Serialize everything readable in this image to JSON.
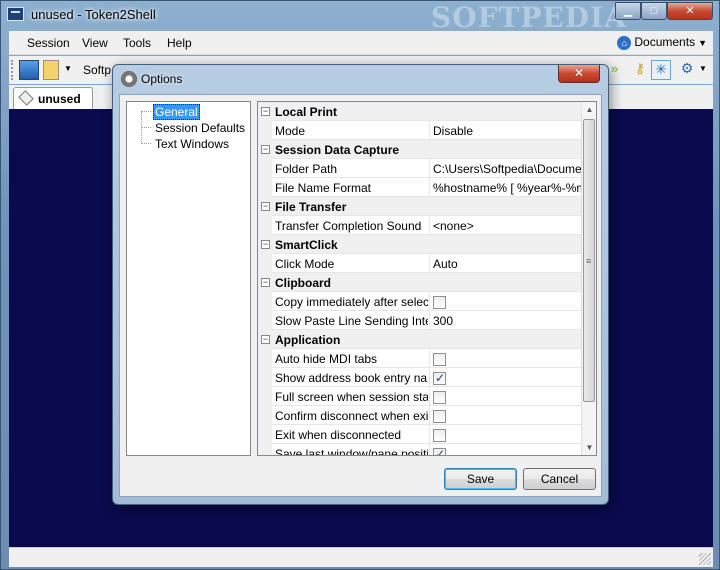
{
  "window": {
    "title": "unused - Token2Shell",
    "watermark": "SOFTPEDIA"
  },
  "menubar": {
    "items": [
      "Session",
      "View",
      "Tools",
      "Help"
    ],
    "documents_label": "Documents"
  },
  "toolbar": {
    "address_text": "Softp"
  },
  "tabs": [
    {
      "label": "unused"
    }
  ],
  "dialog": {
    "title": "Options",
    "tree": [
      "General",
      "Session Defaults",
      "Text Windows"
    ],
    "selected_tree_item": "General",
    "categories": [
      {
        "name": "Local Print",
        "rows": [
          {
            "name": "Mode",
            "value": "Disable"
          }
        ]
      },
      {
        "name": "Session Data Capture",
        "rows": [
          {
            "name": "Folder Path",
            "value": "C:\\Users\\Softpedia\\Docume"
          },
          {
            "name": "File Name Format",
            "value": "%hostname% [ %year%-%m"
          }
        ]
      },
      {
        "name": "File Transfer",
        "rows": [
          {
            "name": "Transfer Completion Sound",
            "value": "<none>"
          }
        ]
      },
      {
        "name": "SmartClick",
        "rows": [
          {
            "name": "Click Mode",
            "value": "Auto"
          }
        ]
      },
      {
        "name": "Clipboard",
        "rows": [
          {
            "name": "Copy immediately after selec",
            "checkbox": false
          },
          {
            "name": "Slow Paste Line Sending Inter",
            "value": "300"
          }
        ]
      },
      {
        "name": "Application",
        "rows": [
          {
            "name": "Auto hide MDI tabs",
            "checkbox": false
          },
          {
            "name": "Show address book entry nar",
            "checkbox": true
          },
          {
            "name": "Full screen when session start",
            "checkbox": false
          },
          {
            "name": "Confirm disconnect when exi",
            "checkbox": false
          },
          {
            "name": "Exit when disconnected",
            "checkbox": false
          },
          {
            "name": "Save last window/pane positi",
            "checkbox": true
          }
        ]
      }
    ],
    "save_label": "Save",
    "cancel_label": "Cancel"
  }
}
